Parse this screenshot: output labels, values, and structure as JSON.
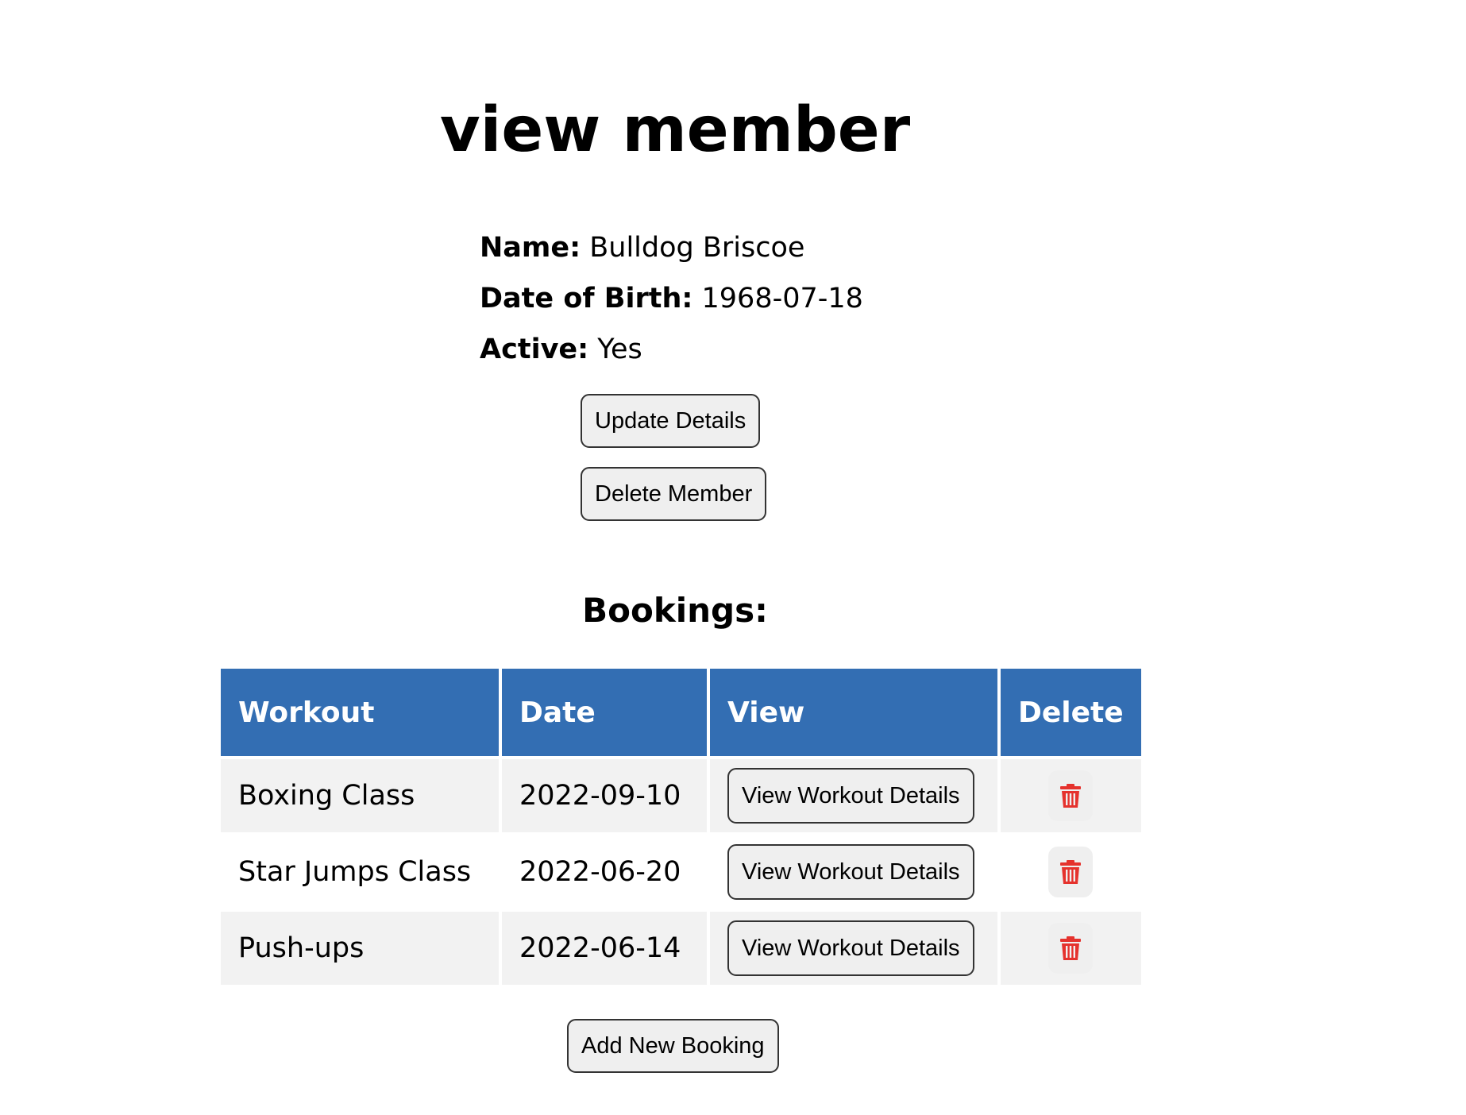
{
  "page": {
    "title": "view member"
  },
  "member": {
    "name_label": "Name:",
    "name": "Bulldog Briscoe",
    "dob_label": "Date of Birth:",
    "dob": "1968-07-18",
    "active_label": "Active:",
    "active": "Yes"
  },
  "actions": {
    "update_label": "Update Details",
    "delete_label": "Delete Member"
  },
  "bookings": {
    "title": "Bookings:",
    "headers": {
      "workout": "Workout",
      "date": "Date",
      "view": "View",
      "delete": "Delete"
    },
    "rows": [
      {
        "workout": "Boxing Class",
        "date": "2022-09-10",
        "view_label": "View Workout Details",
        "delete_icon": "trash-icon"
      },
      {
        "workout": "Star Jumps Class",
        "date": "2022-06-20",
        "view_label": "View Workout Details",
        "delete_icon": "trash-icon"
      },
      {
        "workout": "Push-ups",
        "date": "2022-06-14",
        "view_label": "View Workout Details",
        "delete_icon": "trash-icon"
      }
    ],
    "add_label": "Add New Booking"
  },
  "colors": {
    "header_bg": "#336eb3",
    "row_alt_bg": "#f2f2f2",
    "delete_icon": "#e5322d"
  }
}
